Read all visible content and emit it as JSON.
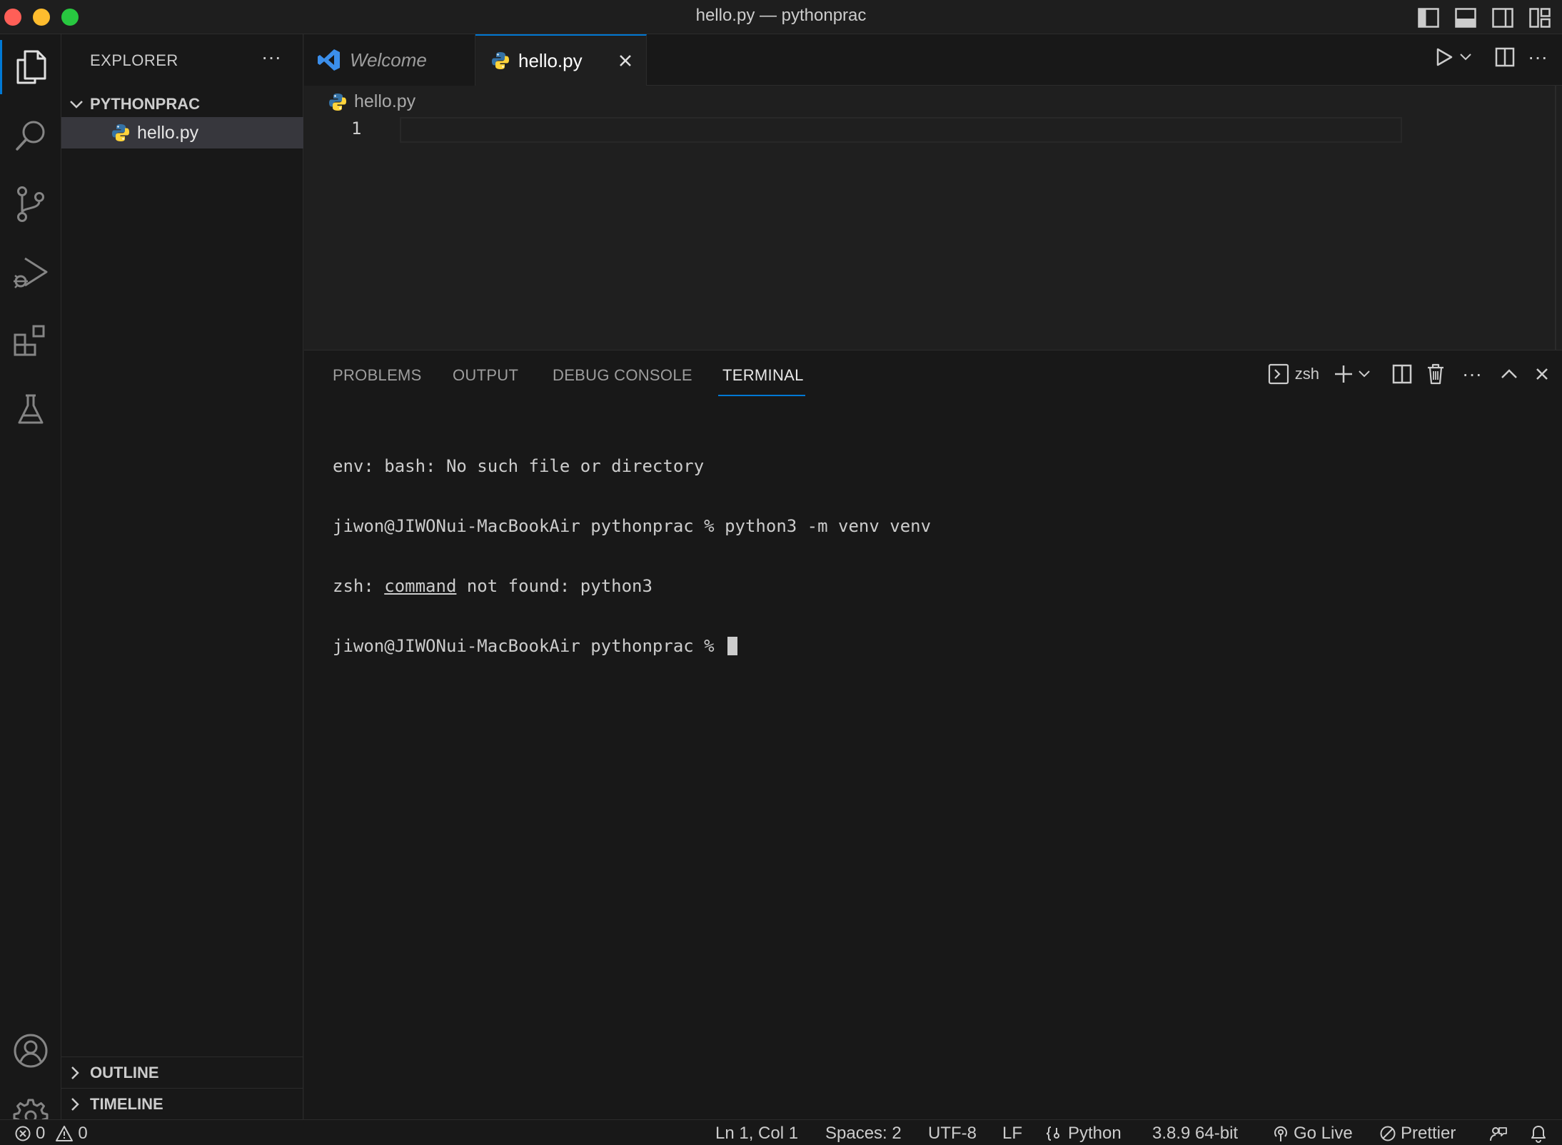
{
  "window": {
    "title": "hello.py — pythonprac",
    "traffic_colors": {
      "close": "#ff5f57",
      "minimize": "#febc2e",
      "zoom": "#28c840"
    }
  },
  "theme": {
    "accent": "#0078d4",
    "python_blue": "#3572A5",
    "python_yellow": "#FFD43B",
    "vscode_blue": "#3b8eea"
  },
  "activity_bar": {
    "items": [
      "explorer-icon",
      "search-icon",
      "source-control-icon",
      "run-debug-icon",
      "extensions-icon",
      "testing-icon"
    ],
    "bottom": [
      "accounts-icon",
      "manage-gear-icon"
    ]
  },
  "sidebar": {
    "header": "EXPLORER",
    "folder": "PYTHONPRAC",
    "files": [
      {
        "name": "hello.py",
        "icon": "python-file-icon"
      }
    ],
    "sections": [
      "OUTLINE",
      "TIMELINE"
    ]
  },
  "tabs": [
    {
      "label": "Welcome",
      "icon": "vscode-icon",
      "active": false
    },
    {
      "label": "hello.py",
      "icon": "python-file-icon",
      "active": true
    }
  ],
  "editor": {
    "breadcrumb": "hello.py",
    "line_numbers": [
      "1"
    ]
  },
  "panel": {
    "tabs": [
      "PROBLEMS",
      "OUTPUT",
      "DEBUG CONSOLE",
      "TERMINAL"
    ],
    "active_tab": "TERMINAL",
    "terminal_name": "zsh",
    "terminal_lines": [
      {
        "text": "env: bash: No such file or directory"
      },
      {
        "text": "jiwon@JIWONui-MacBookAir pythonprac % python3 -m venv venv"
      },
      {
        "pre": "zsh: ",
        "link": "command",
        "post": " not found: python3"
      },
      {
        "text": "jiwon@JIWONui-MacBookAir pythonprac % "
      }
    ]
  },
  "status_bar": {
    "errors": "0",
    "warnings": "0",
    "position": "Ln 1, Col 1",
    "spaces": "Spaces: 2",
    "encoding": "UTF-8",
    "eol": "LF",
    "language": "Python",
    "interpreter": "3.8.9 64-bit",
    "go_live": "Go Live",
    "prettier": "Prettier"
  }
}
